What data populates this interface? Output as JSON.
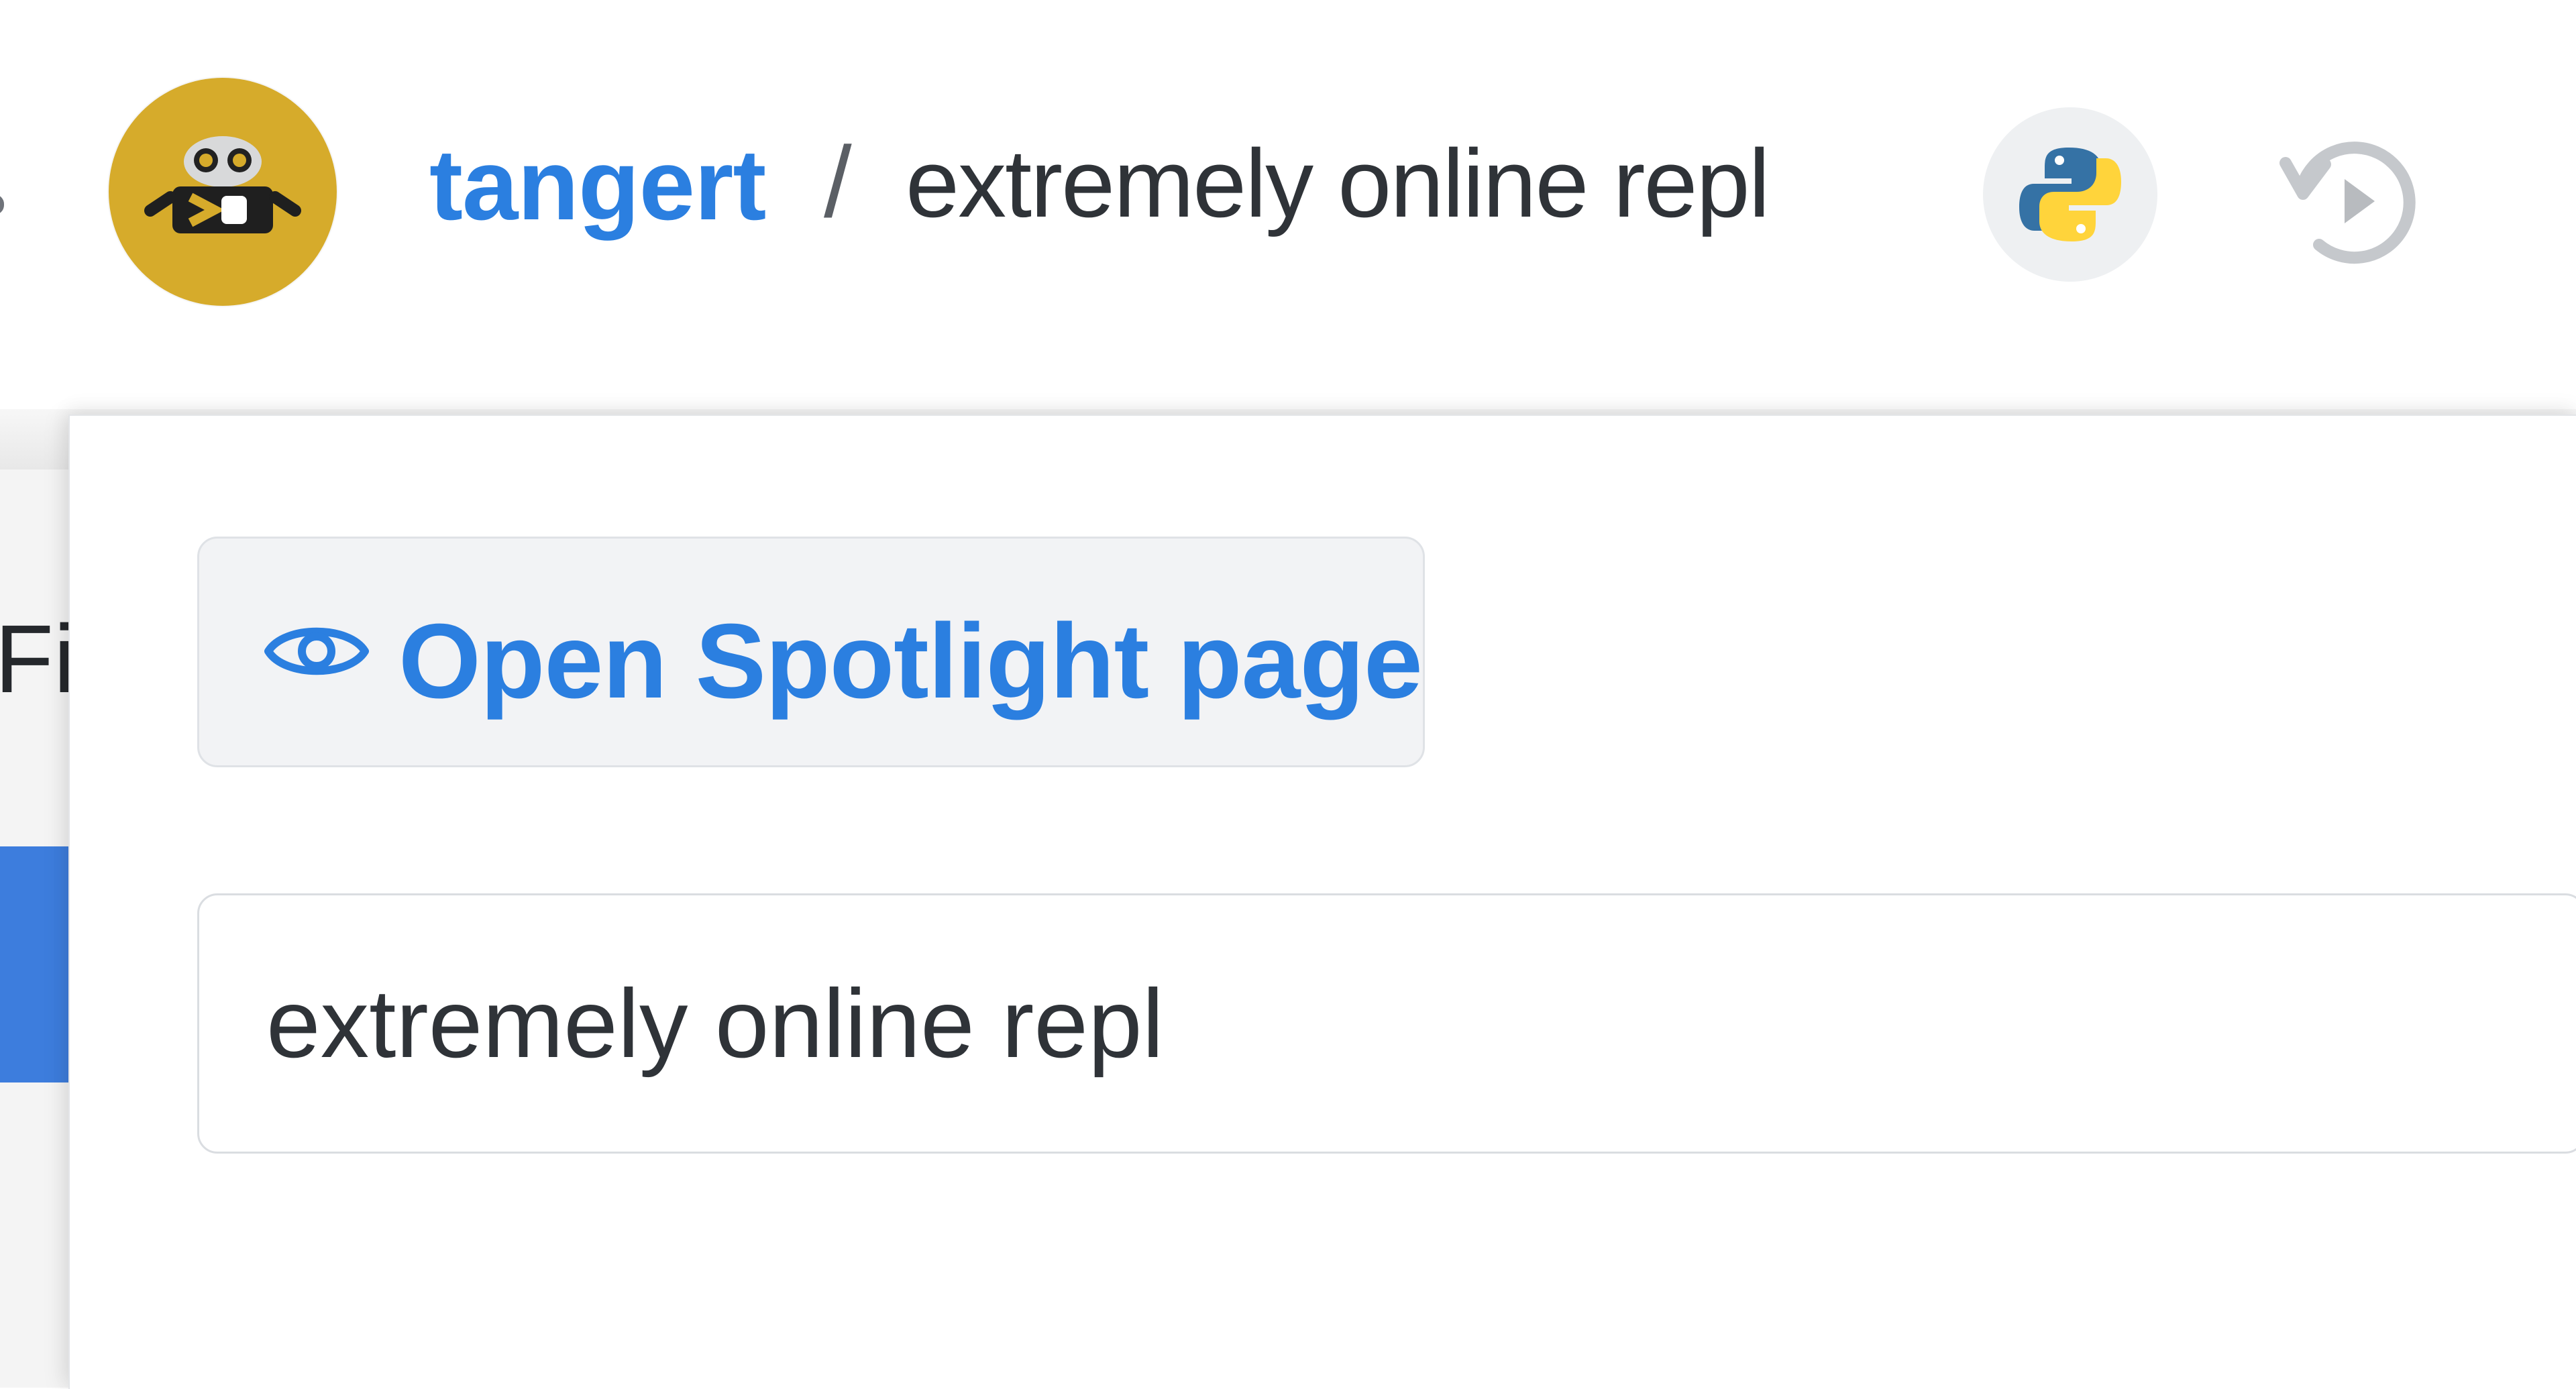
{
  "breadcrumb": {
    "owner": "tangert",
    "separator": "/",
    "repl_name": "extremely online repl"
  },
  "icons": {
    "avatar": "robot-avatar-icon",
    "language": "python-logo-icon",
    "history": "history-play-icon",
    "spotlight": "eye-icon"
  },
  "popover": {
    "spotlight_button_label": "Open Spotlight page",
    "title_field_value": "extremely online repl"
  },
  "background": {
    "partial_label": "Fi"
  },
  "colors": {
    "accent": "#2b7fe0",
    "avatar_background": "#d6ab2b",
    "python_blue": "#3572a5",
    "python_yellow": "#ffd43b"
  }
}
